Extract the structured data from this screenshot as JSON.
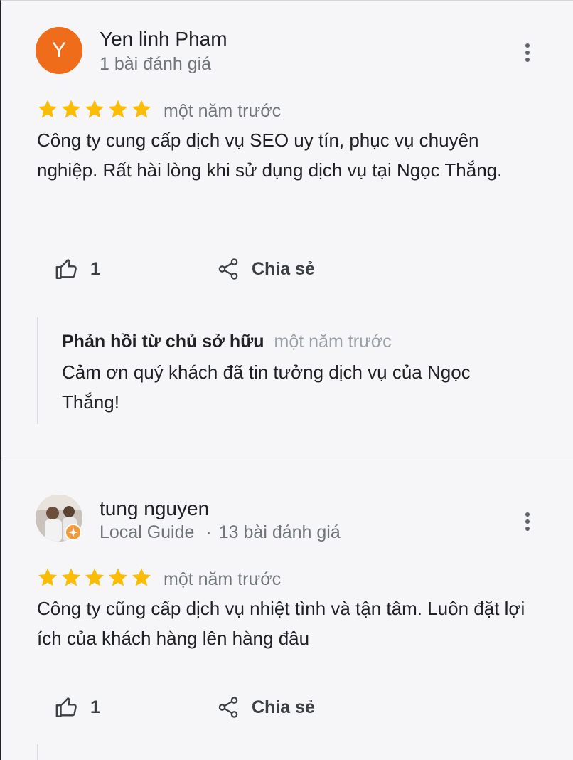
{
  "reviews": [
    {
      "avatar_letter": "Y",
      "avatar_color": "#ef6c1a",
      "name": "Yen linh Pham",
      "meta": "1 bài đánh giá",
      "rating": 5,
      "time": "một năm trước",
      "text": "Công ty cung cấp dịch vụ SEO uy tín, phục vụ chuyên nghiệp. Rất hài lòng khi sử dụng dịch vụ tại Ngọc Thắng.",
      "likes": "1",
      "share_label": "Chia sẻ",
      "reply": {
        "owner_label": "Phản hồi từ chủ sở hữu",
        "time": "một năm trước",
        "text": "Cảm ơn quý khách đã tin tưởng dịch vụ của Ngọc Thắng!"
      }
    },
    {
      "avatar_icon": "user-photo",
      "name": "tung nguyen",
      "badge": "Local Guide",
      "separator": "·",
      "meta": "13 bài đánh giá",
      "rating": 5,
      "time": "một năm trước",
      "text": "Công ty cũng cấp dịch vụ nhiệt tình và tận tâm. Luôn đặt lợi ích của khách hàng lên hàng đâu",
      "likes": "1",
      "share_label": "Chia sẻ"
    }
  ],
  "colors": {
    "star": "#fbbc04",
    "secondary_text": "#70757a",
    "divider": "#dadce0"
  }
}
